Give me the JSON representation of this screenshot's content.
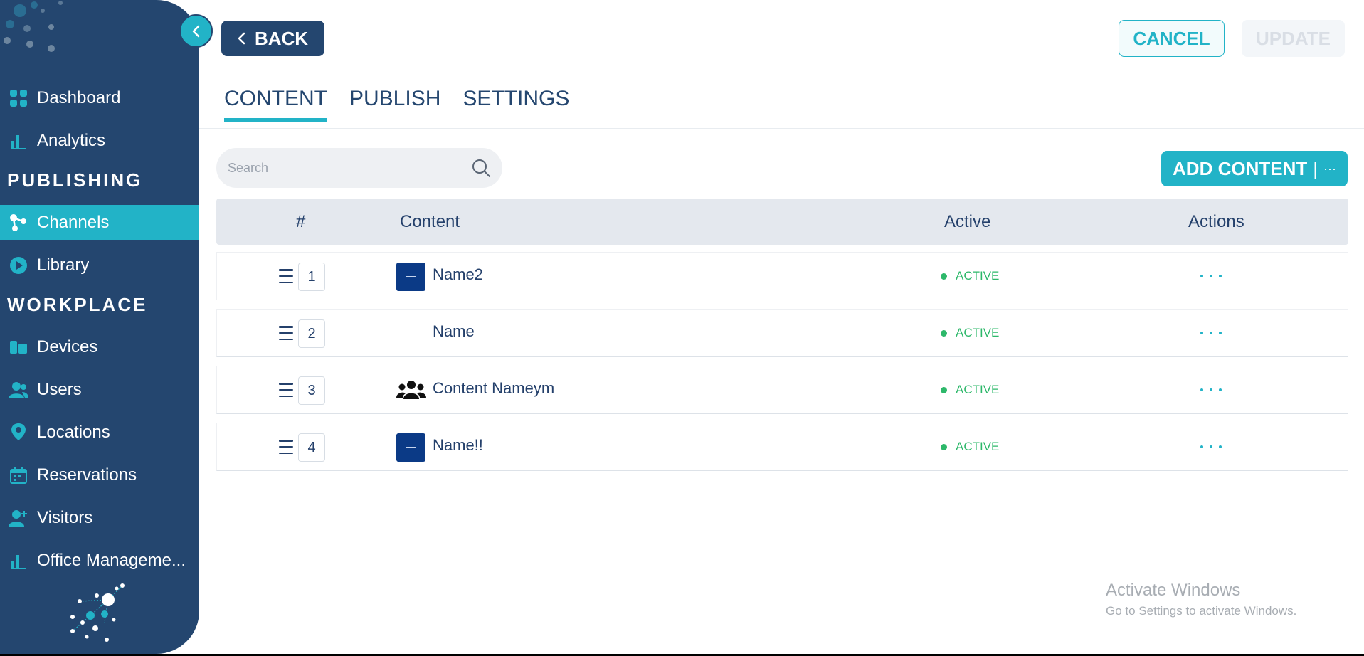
{
  "sidebar": {
    "nav_top": [
      {
        "label": "Dashboard",
        "icon": "grid-icon"
      },
      {
        "label": "Analytics",
        "icon": "bar-chart-icon"
      }
    ],
    "publishing_title": "PUBLISHING",
    "publishing_items": [
      {
        "label": "Channels",
        "icon": "channels-icon",
        "active": true
      },
      {
        "label": "Library",
        "icon": "play-icon"
      }
    ],
    "workplace_title": "WORKPLACE",
    "workplace_items": [
      {
        "label": "Devices",
        "icon": "devices-icon"
      },
      {
        "label": "Users",
        "icon": "users-icon"
      },
      {
        "label": "Locations",
        "icon": "location-pin-icon"
      },
      {
        "label": "Reservations",
        "icon": "calendar-icon"
      },
      {
        "label": "Visitors",
        "icon": "user-plus-icon"
      },
      {
        "label": "Office Manageme...",
        "icon": "bar-chart-icon"
      }
    ]
  },
  "header": {
    "back_label": "BACK",
    "cancel_label": "CANCEL",
    "update_label": "UPDATE"
  },
  "tabs": [
    {
      "label": "CONTENT",
      "active": true
    },
    {
      "label": "PUBLISH"
    },
    {
      "label": "SETTINGS"
    }
  ],
  "search": {
    "placeholder": "Search",
    "value": ""
  },
  "add_content": {
    "label": "ADD CONTENT",
    "separator": "|",
    "more": "···"
  },
  "table": {
    "columns": [
      "#",
      "Content",
      "Active",
      "Actions"
    ],
    "rows": [
      {
        "order": "1",
        "name": "Name2",
        "thumb": "image",
        "status": "ACTIVE"
      },
      {
        "order": "2",
        "name": "Name",
        "thumb": "none",
        "status": "ACTIVE"
      },
      {
        "order": "3",
        "name": "Content Nameym",
        "thumb": "group-icon",
        "status": "ACTIVE"
      },
      {
        "order": "4",
        "name": "Name!!",
        "thumb": "image",
        "status": "ACTIVE"
      }
    ]
  },
  "watermark": {
    "title": "Activate Windows",
    "subtitle": "Go to Settings to activate Windows."
  },
  "colors": {
    "sidebar": "#24466f",
    "accent": "#22b3c7",
    "active_status": "#2db86a"
  }
}
